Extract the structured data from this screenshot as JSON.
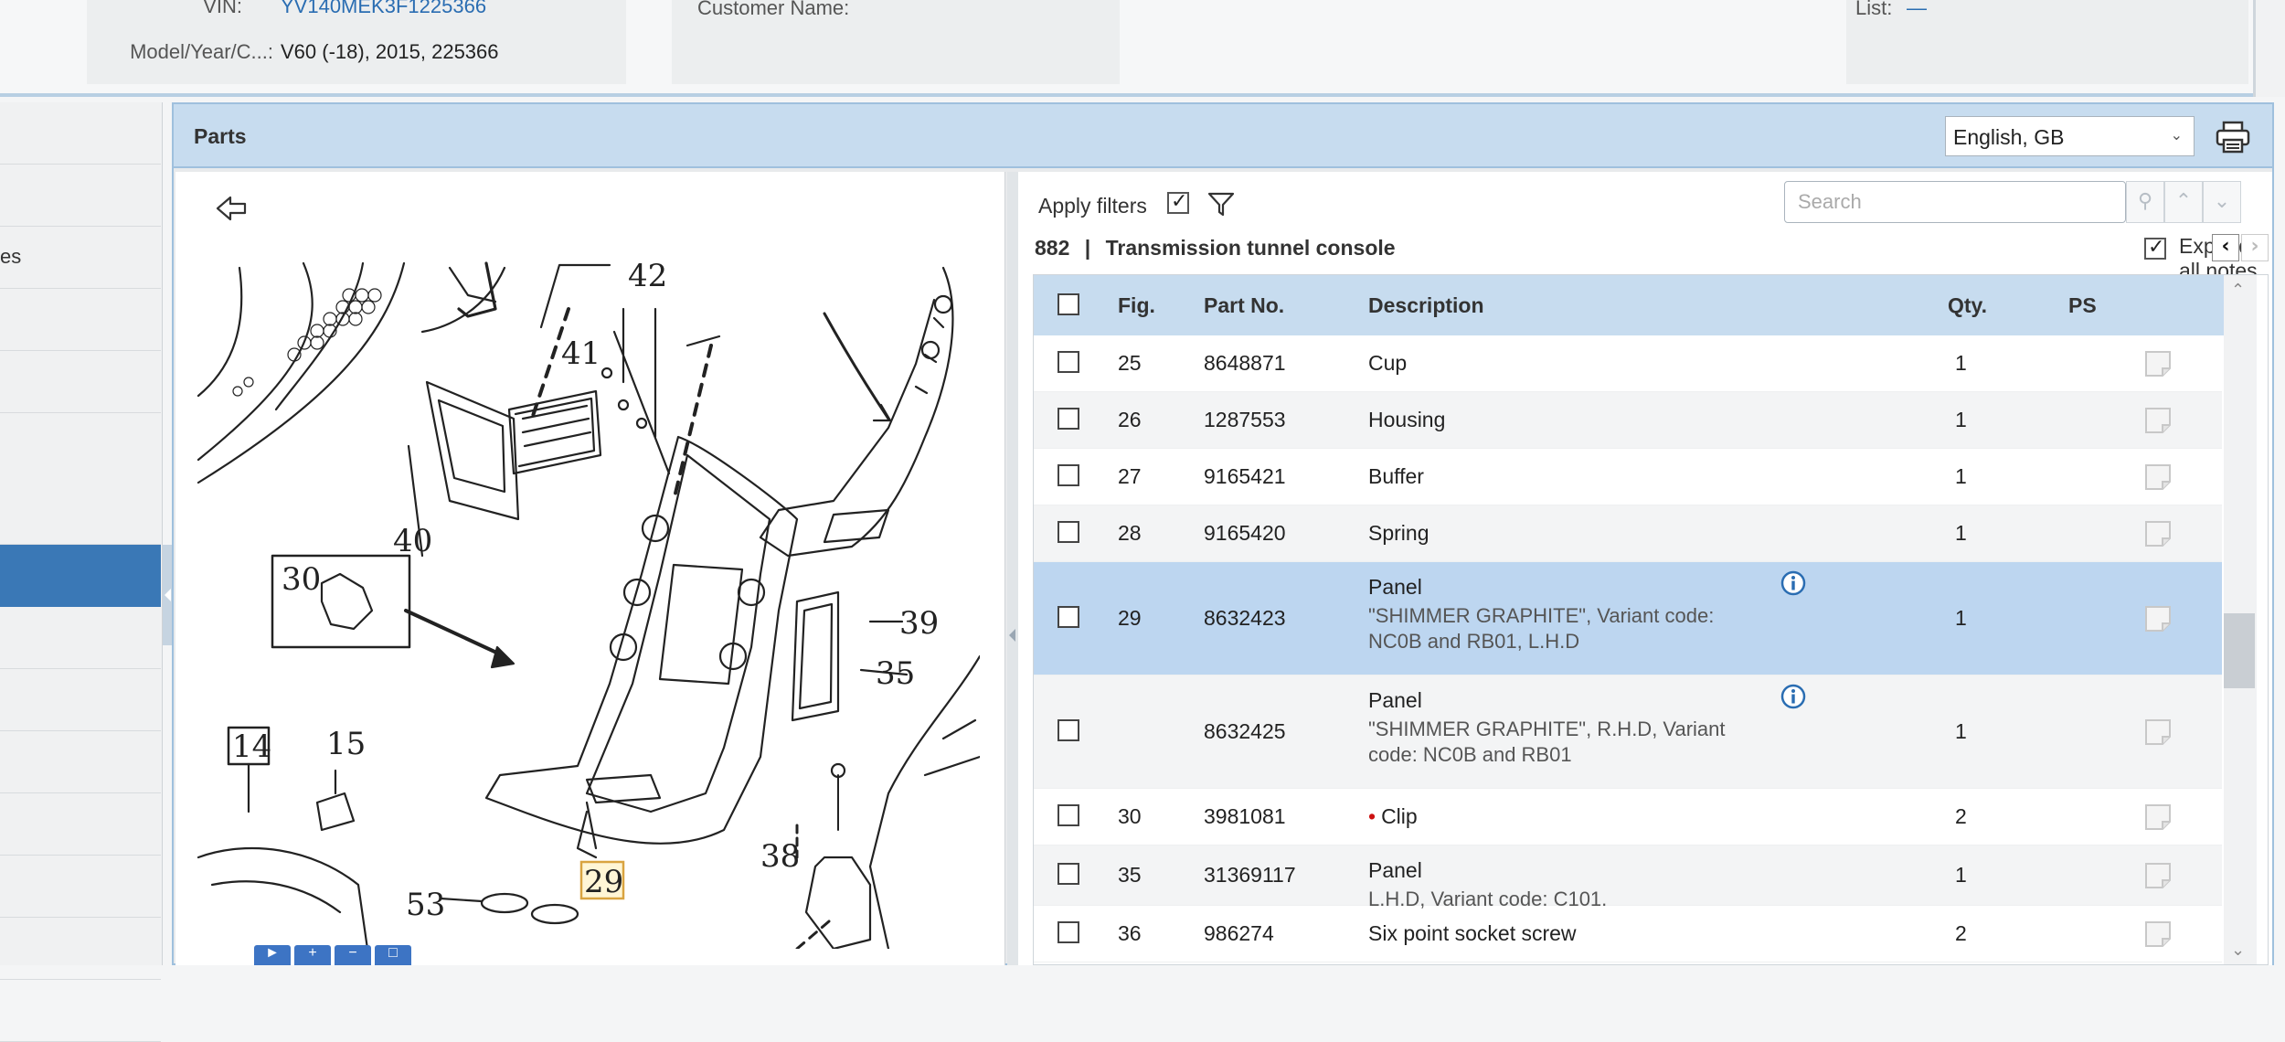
{
  "vehicle": {
    "vin_label": "VIN:",
    "vin_value": "YV140MEK3F1225366",
    "model_label": "Model/Year/C...:",
    "model_value": "V60 (-18), 2015, 225366",
    "customer_label": "Customer Name:",
    "list_label": "List:",
    "list_value": "—"
  },
  "nav": {
    "items": [
      {
        "label": ""
      },
      {
        "label": ""
      },
      {
        "label": "es"
      },
      {
        "label": ""
      },
      {
        "label": ""
      },
      {
        "label": ""
      },
      {
        "label": ""
      },
      {
        "label": ""
      },
      {
        "label": ""
      },
      {
        "label": ""
      },
      {
        "label": ""
      },
      {
        "label": ""
      },
      {
        "label": ""
      }
    ],
    "active_index": 5
  },
  "parts": {
    "title": "Parts",
    "language": "English, GB"
  },
  "diagram": {
    "labels": {
      "n42": "42",
      "n41": "41",
      "n40": "40",
      "n30": "30",
      "n39": "39",
      "n35": "35",
      "n14": "14",
      "n15": "15",
      "n38": "38",
      "n29": "29",
      "n53": "53"
    }
  },
  "list": {
    "apply_filters_label": "Apply filters",
    "apply_filters_checked": true,
    "group_number": "882",
    "group_separator": "|",
    "group_name": "Transmission tunnel console",
    "search_placeholder": "Search",
    "expand_notes_label": "Expand all notes",
    "expand_notes_checked": true
  },
  "table": {
    "headers": {
      "fig": "Fig.",
      "part_no": "Part No.",
      "description": "Description",
      "qty": "Qty.",
      "ps": "PS"
    },
    "rows": [
      {
        "fig": "25",
        "part_no": "8648871",
        "description": "Cup",
        "note": "",
        "qty": "1",
        "info": false,
        "bullet": false
      },
      {
        "fig": "26",
        "part_no": "1287553",
        "description": "Housing",
        "note": "",
        "qty": "1",
        "info": false,
        "bullet": false
      },
      {
        "fig": "27",
        "part_no": "9165421",
        "description": "Buffer",
        "note": "",
        "qty": "1",
        "info": false,
        "bullet": false
      },
      {
        "fig": "28",
        "part_no": "9165420",
        "description": "Spring",
        "note": "",
        "qty": "1",
        "info": false,
        "bullet": false
      },
      {
        "fig": "29",
        "part_no": "8632423",
        "description": "Panel",
        "note": "\"SHIMMER GRAPHITE\", Variant code: NC0B and RB01, L.H.D",
        "qty": "1",
        "info": true,
        "bullet": false
      },
      {
        "fig": "",
        "part_no": "8632425",
        "description": "Panel",
        "note": "\"SHIMMER GRAPHITE\", R.H.D, Variant code: NC0B and RB01",
        "qty": "1",
        "info": true,
        "bullet": false
      },
      {
        "fig": "30",
        "part_no": "3981081",
        "description": "Clip",
        "note": "",
        "qty": "2",
        "info": false,
        "bullet": true
      },
      {
        "fig": "35",
        "part_no": "31369117",
        "description": "Panel",
        "note": "L.H.D, Variant code: C101.",
        "qty": "1",
        "info": false,
        "bullet": false
      },
      {
        "fig": "36",
        "part_no": "986274",
        "description": "Six point socket screw",
        "note": "",
        "qty": "2",
        "info": false,
        "bullet": false
      }
    ],
    "selected_index": 4
  },
  "colors": {
    "header_blue": "#c7dcef",
    "selected_row": "#bdd6f0",
    "active_nav": "#3a78b6",
    "link": "#2a6db2",
    "bullet_red": "#cc1111"
  },
  "icons": [
    "back-arrow-icon",
    "filter-icon",
    "search-icon",
    "chevron-up-icon",
    "chevron-down-icon",
    "print-icon",
    "info-icon",
    "note-icon",
    "chevron-left-icon",
    "chevron-right-icon"
  ]
}
